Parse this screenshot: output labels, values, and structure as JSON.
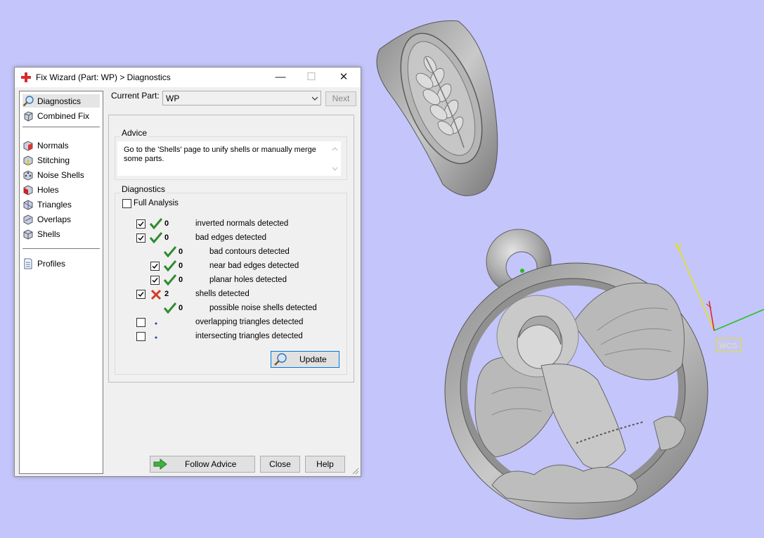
{
  "window": {
    "title": "Fix Wizard (Part: WP) > Diagnostics",
    "minimize": "—",
    "maximize": "☐",
    "close": "✕"
  },
  "nav": {
    "items": [
      {
        "label": "Diagnostics",
        "icon": "magnifier-icon",
        "selected": true
      },
      {
        "label": "Combined Fix",
        "icon": "cube-icon"
      },
      {
        "label": "Normals",
        "icon": "cube-red-face-icon"
      },
      {
        "label": "Stitching",
        "icon": "cube-yellow-edge-icon"
      },
      {
        "label": "Noise Shells",
        "icon": "dotted-cube-icon"
      },
      {
        "label": "Holes",
        "icon": "cube-hole-icon"
      },
      {
        "label": "Triangles",
        "icon": "triangle-cube-icon"
      },
      {
        "label": "Overlaps",
        "icon": "cube-overlap-icon"
      },
      {
        "label": "Shells",
        "icon": "cube-icon"
      },
      {
        "label": "Profiles",
        "icon": "document-icon"
      }
    ]
  },
  "header": {
    "current_part_label": "Current Part:",
    "current_part_value": "WP",
    "next_label": "Next"
  },
  "advice": {
    "title": "Advice",
    "text": "Go to the 'Shells' page to unify shells or manually merge some parts."
  },
  "diagnostics": {
    "title": "Diagnostics",
    "full_analysis_label": "Full Analysis",
    "full_analysis_checked": false,
    "rows": [
      {
        "checkbox": true,
        "checked": true,
        "status": "ok",
        "count": "0",
        "label": "inverted normals detected",
        "indent": 0
      },
      {
        "checkbox": true,
        "checked": true,
        "status": "ok",
        "count": "0",
        "label": "bad edges detected",
        "indent": 0
      },
      {
        "checkbox": false,
        "status": "ok",
        "count": "0",
        "label": "bad contours detected",
        "indent": 1
      },
      {
        "checkbox": true,
        "checked": true,
        "status": "ok",
        "count": "0",
        "label": "near bad edges detected",
        "indent": 1
      },
      {
        "checkbox": true,
        "checked": true,
        "status": "ok",
        "count": "0",
        "label": "planar holes detected",
        "indent": 1
      },
      {
        "checkbox": true,
        "checked": true,
        "status": "error",
        "count": "2",
        "label": "shells detected",
        "indent": 0
      },
      {
        "checkbox": false,
        "status": "ok",
        "count": "0",
        "label": "possible noise shells detected",
        "indent": 1
      },
      {
        "checkbox": true,
        "checked": false,
        "status": "none",
        "count": "",
        "label": "overlapping triangles detected",
        "indent": 0
      },
      {
        "checkbox": true,
        "checked": false,
        "status": "none",
        "count": "",
        "label": "intersecting triangles detected",
        "indent": 0
      }
    ],
    "update_label": "Update"
  },
  "footer": {
    "follow_advice_label": "Follow Advice",
    "close_label": "Close",
    "help_label": "Help"
  },
  "viewport": {
    "axis_label": "WCS",
    "axis_colors": {
      "x": "#22c422",
      "y": "#e6e600",
      "z": "#e02020"
    }
  },
  "colors": {
    "background": "#c4c5fa",
    "ok_check": "#2e8b2e",
    "error_x": "#d23a2a",
    "accent": "#0078d7"
  }
}
